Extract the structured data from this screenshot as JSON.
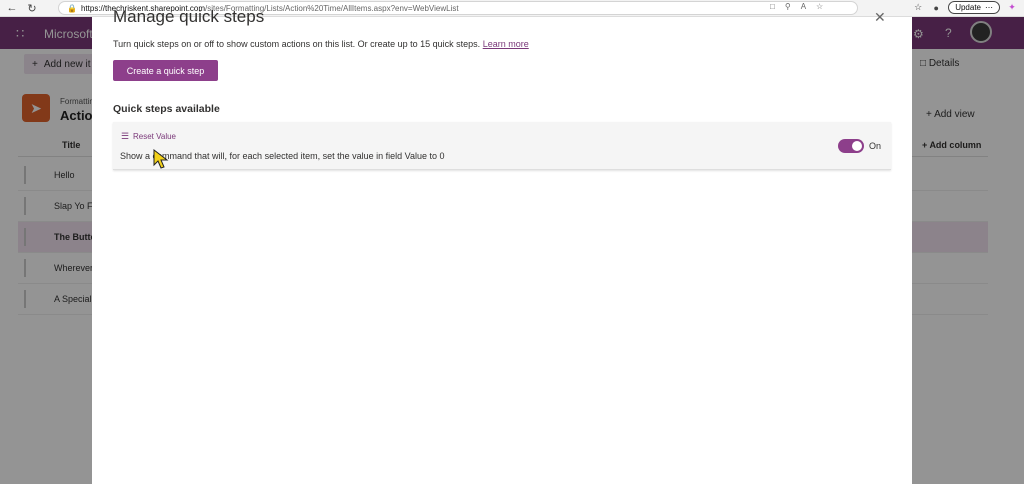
{
  "browser": {
    "url_host": "https://thechriskent.sharepoint.com",
    "url_path": "/sites/Formatting/Lists/Action%20Time/AllItems.aspx?env=WebViewList",
    "update_label": "Update"
  },
  "sharepoint": {
    "brand": "Microsoft",
    "new_item_label": "Add new it",
    "details_label": "Details",
    "breadcrumb": "Formatting",
    "list_name": "Action",
    "add_view_label": "Add view",
    "columns": {
      "title": "Title",
      "add_column": "Add column"
    },
    "rows": [
      {
        "title": "Hello"
      },
      {
        "title": "Slap Yo Fa"
      },
      {
        "title": "The Butto"
      },
      {
        "title": "Wherever"
      },
      {
        "title": "A Special"
      }
    ]
  },
  "dialog": {
    "title": "Manage quick steps",
    "description": "Turn quick steps on or off to show custom actions on this list. Or create up to 15 quick steps.",
    "learn_more": "Learn more",
    "create_button": "Create a quick step",
    "section_heading": "Quick steps available",
    "quick_steps": [
      {
        "name": "Reset Value",
        "description": "Show a command that will, for each selected item, set the value in field Value to 0",
        "enabled": true,
        "toggle_label": "On"
      }
    ]
  },
  "colors": {
    "accent": "#8d3f8b",
    "suite_bar": "#7a3879",
    "link": "#7a3879"
  }
}
